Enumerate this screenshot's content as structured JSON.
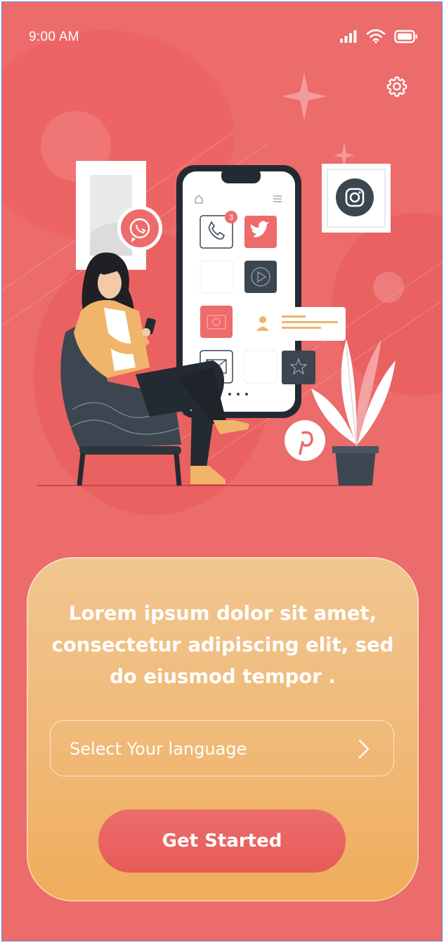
{
  "status_bar": {
    "time": "9:00 AM",
    "icons": [
      "signal-icon",
      "wifi-icon",
      "battery-icon"
    ]
  },
  "header": {
    "settings_icon": "gear-icon"
  },
  "illustration": {
    "notification_count": "3",
    "icons": [
      "whatsapp-icon",
      "instagram-icon",
      "twitter-icon",
      "phone-icon",
      "play-icon",
      "camera-icon",
      "user-icon",
      "mail-icon",
      "star-icon",
      "pinterest-icon",
      "home-icon",
      "menu-icon"
    ]
  },
  "card": {
    "headline": "Lorem ipsum dolor sit amet, consectetur adipiscing elit, sed do eiusmod tempor .",
    "language_placeholder": "Select Your language",
    "cta_label": "Get Started"
  },
  "colors": {
    "background": "#ec6b6b",
    "card_top": "#f1c690",
    "card_bottom": "#f0ad5b",
    "button": "#e85a58",
    "accent_dark": "#3c4650"
  }
}
